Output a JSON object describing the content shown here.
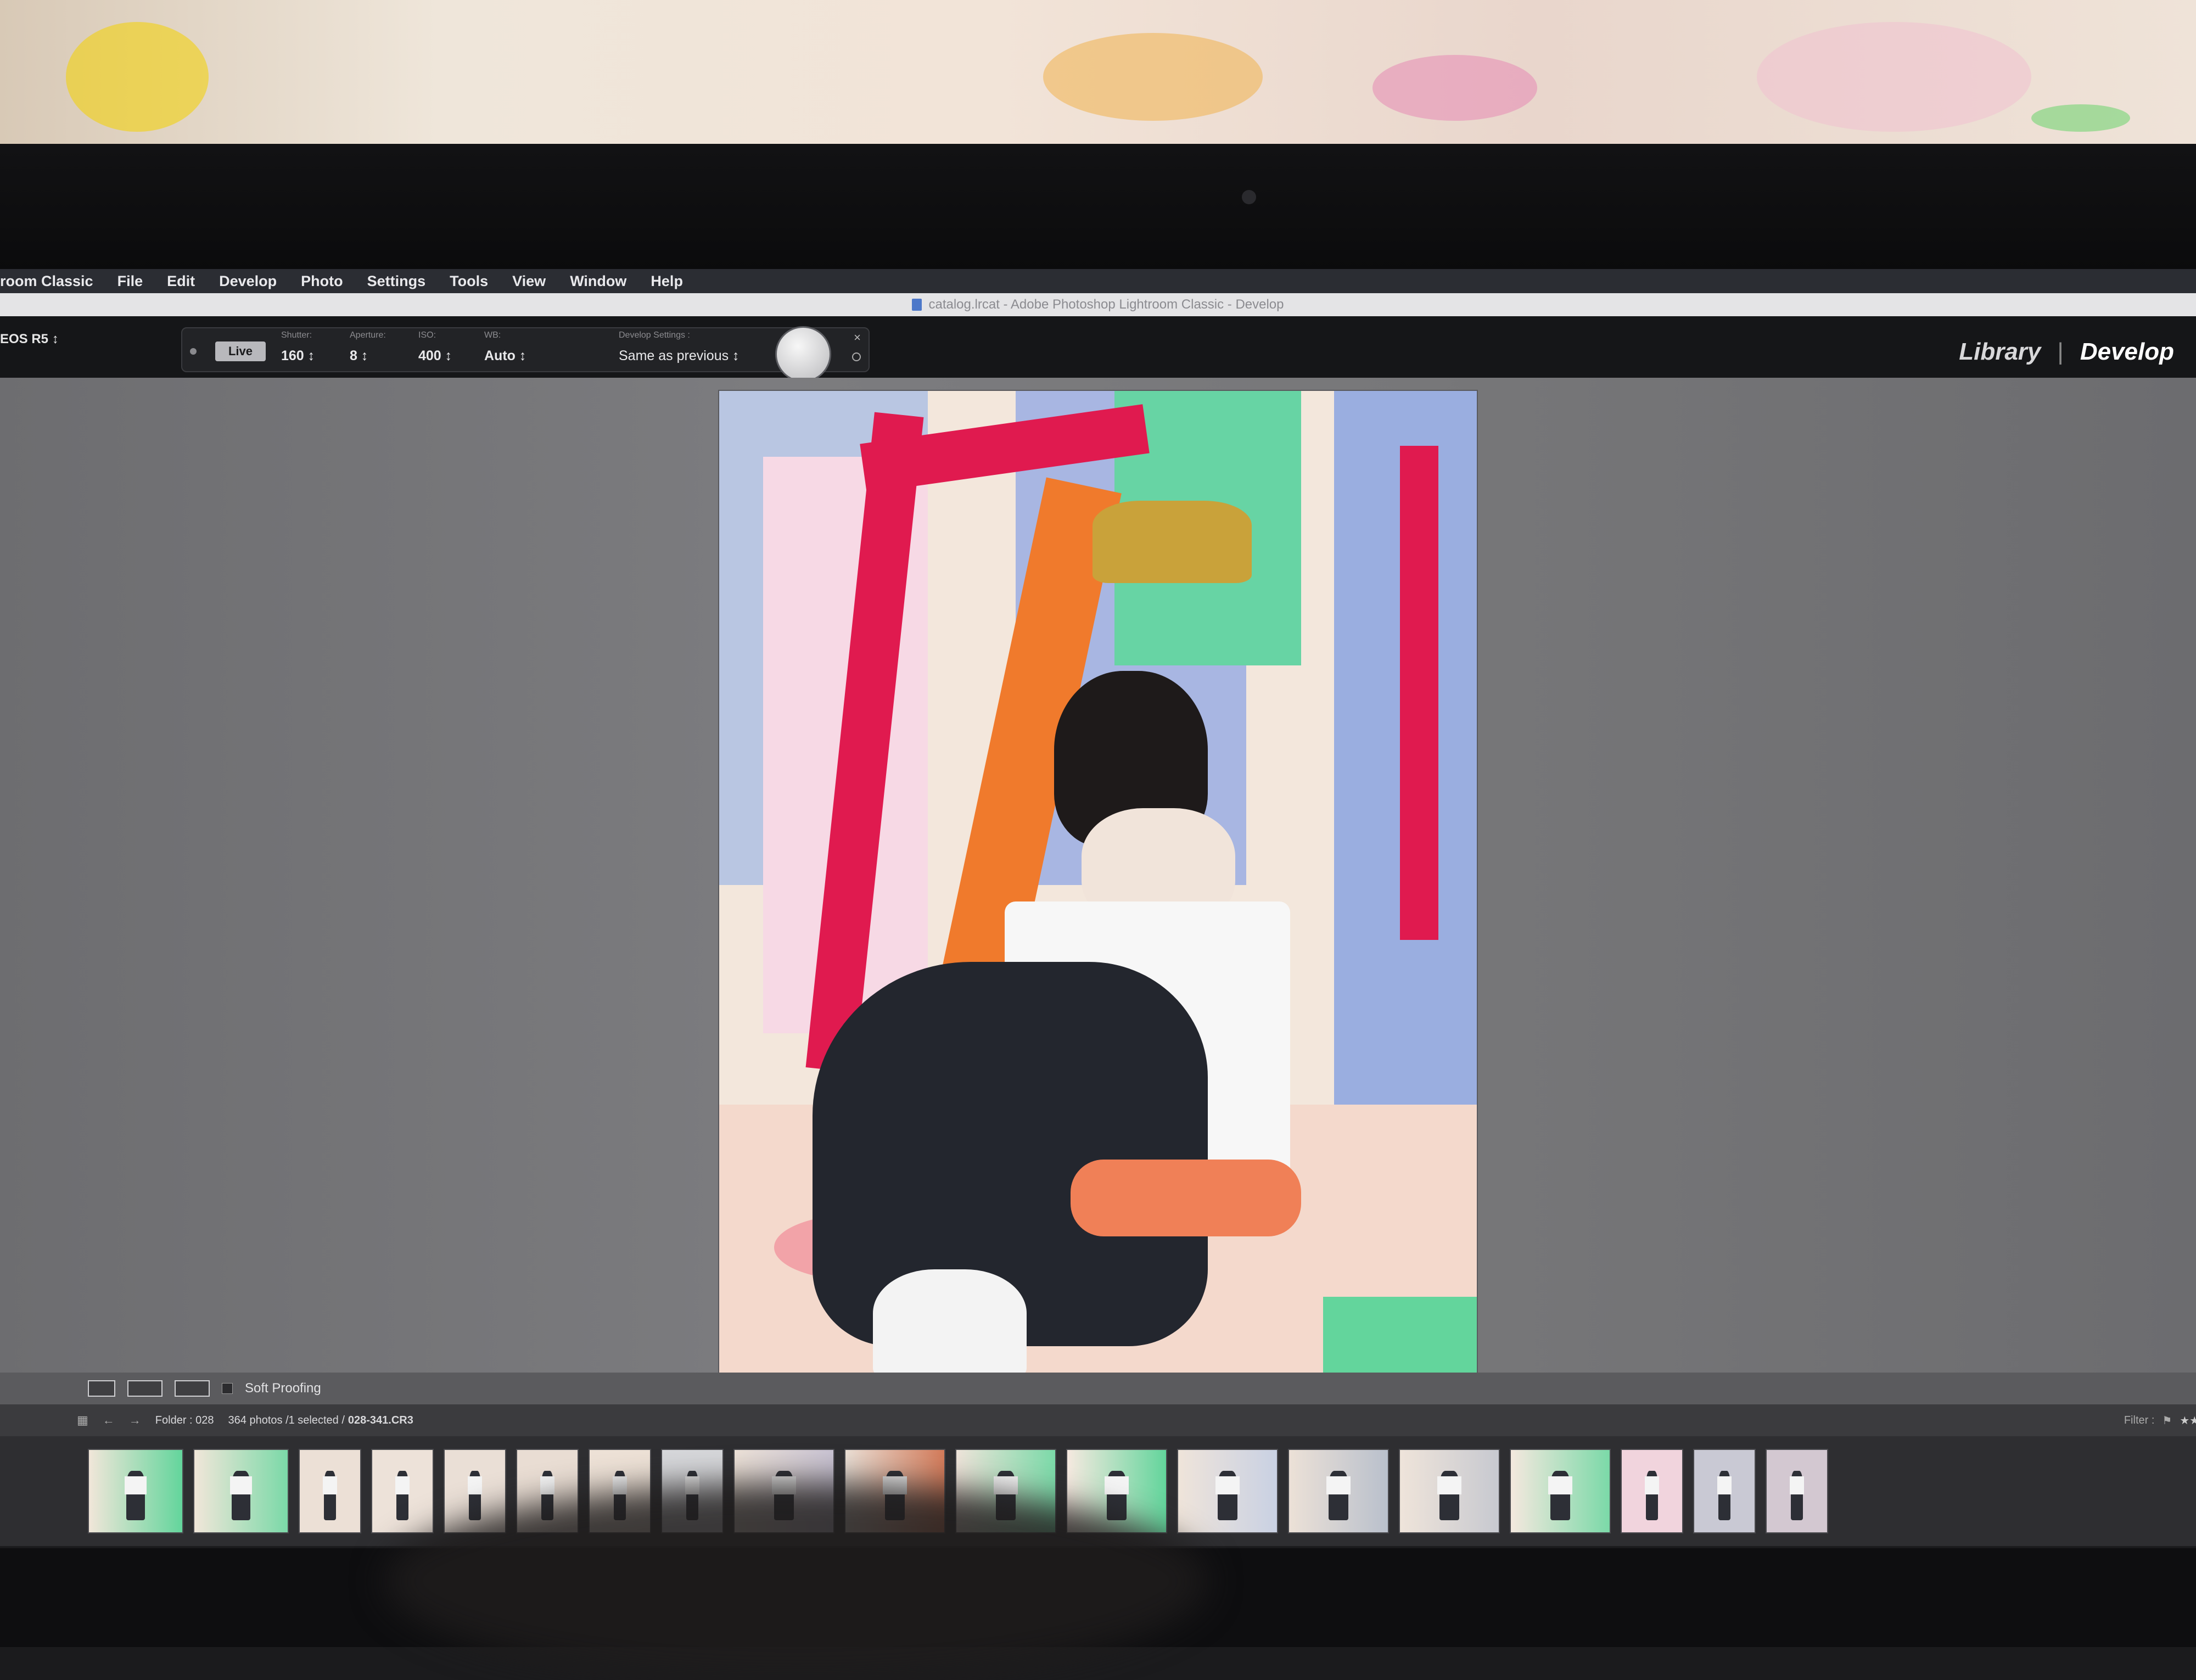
{
  "menubar": {
    "app": "room Classic",
    "items": [
      "File",
      "Edit",
      "Develop",
      "Photo",
      "Settings",
      "Tools",
      "View",
      "Window",
      "Help"
    ]
  },
  "titlebar": {
    "title": "catalog.lrcat - Adobe Photoshop Lightroom Classic - Develop"
  },
  "tether": {
    "camera": "EOS R5",
    "live_label": "Live",
    "shutter": {
      "caption": "Shutter:",
      "value": "160"
    },
    "aperture": {
      "caption": "Aperture:",
      "value": "8"
    },
    "iso": {
      "caption": "ISO:",
      "value": "400"
    },
    "wb": {
      "caption": "WB:",
      "value": "Auto"
    },
    "develop": {
      "caption": "Develop Settings :",
      "value": "Same as previous"
    }
  },
  "modules": {
    "library": "Library",
    "separator": "|",
    "develop": "Develop"
  },
  "toolbar": {
    "soft_proofing": "Soft Proofing"
  },
  "filmbar": {
    "folder": "Folder : 028",
    "count": "364 photos /1 selected /",
    "filename": "028-341.CR3",
    "filter_label": "Filter :"
  },
  "colors": {
    "accent_red": "#e01a4f",
    "panel_bg": "#151618",
    "workspace_bg": "#777779"
  }
}
